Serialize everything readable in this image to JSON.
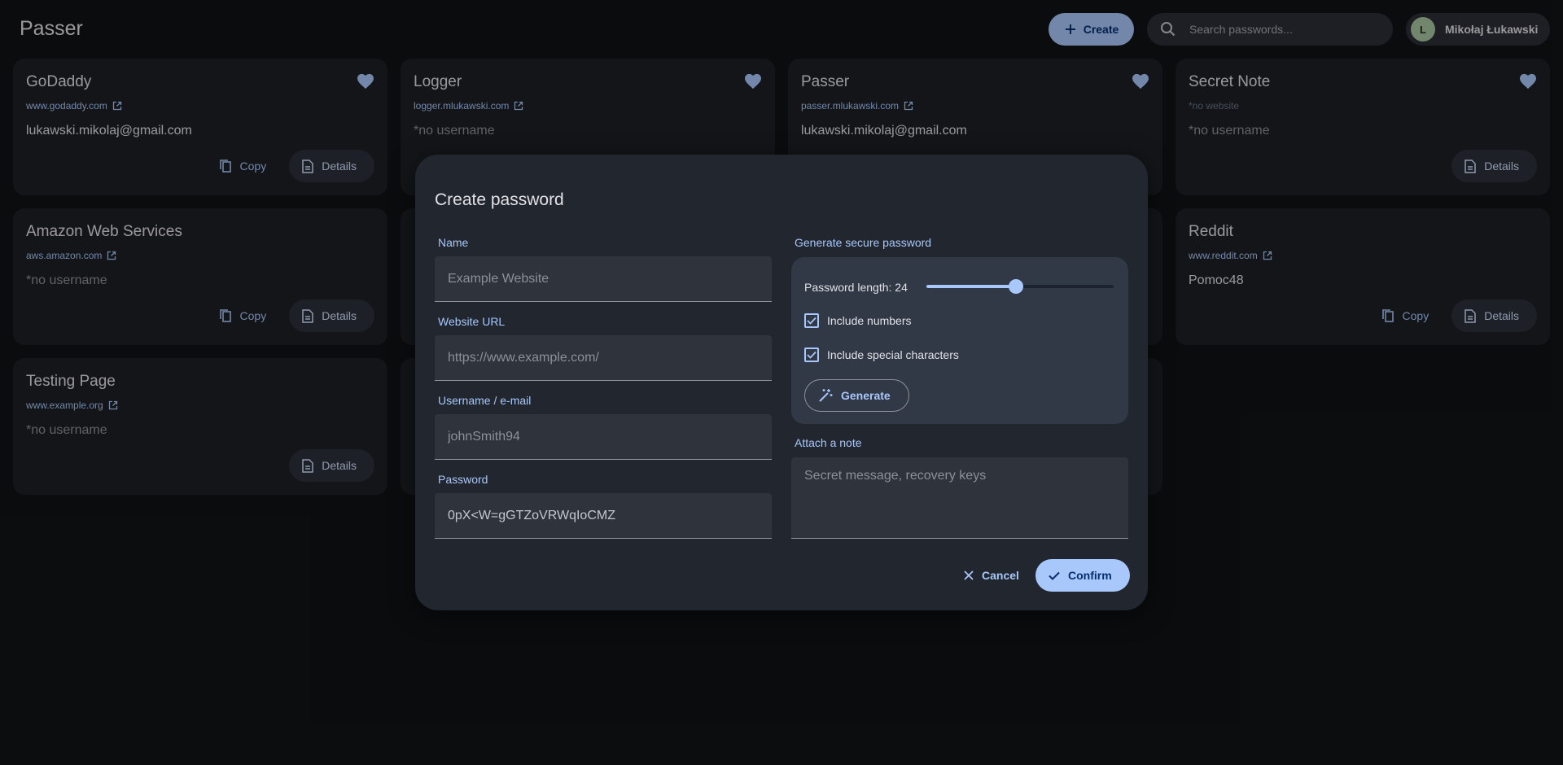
{
  "header": {
    "app_title": "Passer",
    "create_label": "Create",
    "search_placeholder": "Search passwords...",
    "user_initial": "L",
    "user_name": "Mikołaj Łukawski"
  },
  "labels": {
    "copy": "Copy",
    "details": "Details"
  },
  "cards": [
    {
      "title": "GoDaddy",
      "website": "www.godaddy.com",
      "username": "lukawski.mikolaj@gmail.com"
    },
    {
      "title": "Logger",
      "website": "logger.mlukawski.com",
      "username": "*no username"
    },
    {
      "title": "Passer",
      "website": "passer.mlukawski.com",
      "username": "lukawski.mikolaj@gmail.com"
    },
    {
      "title": "Secret Note",
      "website": "*no website",
      "username": "*no username"
    },
    {
      "title": "Amazon Web Services",
      "website": "aws.amazon.com",
      "username": "*no username"
    },
    {
      "title": "Reddit",
      "website": "www.reddit.com",
      "username": "Pomoc48"
    },
    {
      "title": "Testing Page",
      "website": "www.example.org",
      "username": "*no username"
    }
  ],
  "dialog": {
    "title": "Create password",
    "name_label": "Name",
    "name_placeholder": "Example Website",
    "url_label": "Website URL",
    "url_placeholder": "https://www.example.com/",
    "username_label": "Username / e-mail",
    "username_placeholder": "johnSmith94",
    "password_label": "Password",
    "password_value": "0pX<W=gGTZoVRWqIoCMZ",
    "generator": {
      "section_label": "Generate secure password",
      "length_label": "Password length: 24",
      "length_fraction": 0.48,
      "include_numbers": "Include numbers",
      "include_special": "Include special characters",
      "generate_label": "Generate"
    },
    "note_label": "Attach a note",
    "note_placeholder": "Secret message, recovery keys",
    "cancel_label": "Cancel",
    "confirm_label": "Confirm"
  },
  "colors": {
    "accent": "#a8c7fa",
    "background": "#111316",
    "card": "#1d2024",
    "dialog": "#22262e"
  }
}
